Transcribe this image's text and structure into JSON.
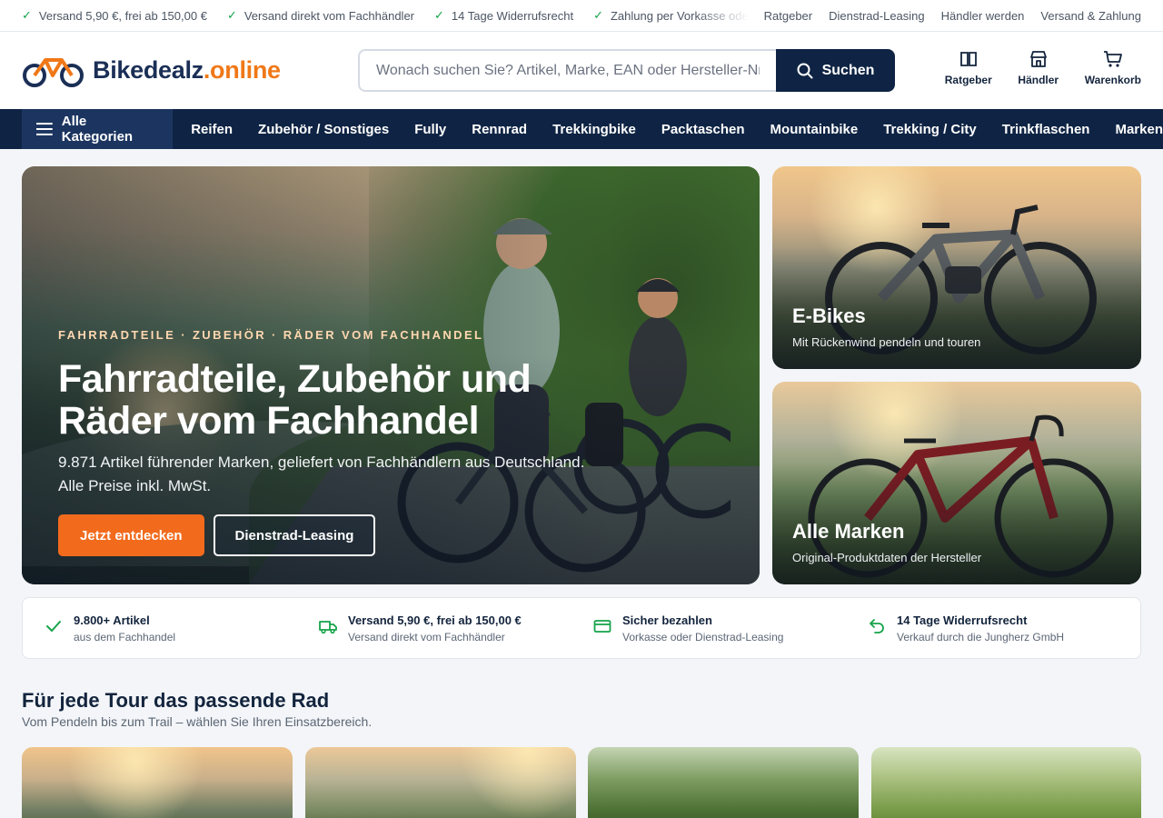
{
  "topbar": {
    "usps": [
      "Versand 5,90 €, frei ab 150,00 €",
      "Versand direkt vom Fachhändler",
      "14 Tage Widerrufsrecht",
      "Zahlung per Vorkasse oder"
    ],
    "links": [
      "Ratgeber",
      "Dienstrad-Leasing",
      "Händler werden",
      "Versand & Zahlung"
    ]
  },
  "header": {
    "logo_main": "Bikedealz",
    "logo_tld": ".online",
    "search_placeholder": "Wonach suchen Sie? Artikel, Marke, EAN oder Hersteller-Nr.",
    "search_button": "Suchen",
    "icons": [
      {
        "label": "Ratgeber",
        "icon": "book-icon"
      },
      {
        "label": "Händler",
        "icon": "store-icon"
      },
      {
        "label": "Warenkorb",
        "icon": "cart-icon"
      }
    ]
  },
  "nav": {
    "all_categories": "Alle Kategorien",
    "items": [
      "Reifen",
      "Zubehör / Sonstiges",
      "Fully",
      "Rennrad",
      "Trekkingbike",
      "Packtaschen",
      "Mountainbike",
      "Trekking / City",
      "Trinkflaschen",
      "Marken"
    ]
  },
  "hero": {
    "kicker": "FAHRRADTEILE · ZUBEHÖR · RÄDER VOM FACHHANDEL",
    "title_line1": "Fahrradteile, Zubehör und",
    "title_line2": "Räder vom Fachhandel",
    "subtitle_line1": "9.871 Artikel führender Marken, geliefert von Fachhändlern aus Deutschland.",
    "subtitle_line2": "Alle Preise inkl. MwSt.",
    "primary_button": "Jetzt entdecken",
    "secondary_button": "Dienstrad-Leasing"
  },
  "side_cards": [
    {
      "title": "E-Bikes",
      "subtitle": "Mit Rückenwind pendeln und touren"
    },
    {
      "title": "Alle Marken",
      "subtitle": "Original-Produktdaten der Hersteller"
    }
  ],
  "features": [
    {
      "title": "9.800+ Artikel",
      "subtitle": "aus dem Fachhandel",
      "icon": "check-icon"
    },
    {
      "title": "Versand 5,90 €, frei ab 150,00 €",
      "subtitle": "Versand direkt vom Fachhändler",
      "icon": "truck-icon"
    },
    {
      "title": "Sicher bezahlen",
      "subtitle": "Vorkasse oder Dienstrad-Leasing",
      "icon": "credit-card-icon"
    },
    {
      "title": "14 Tage Widerrufsrecht",
      "subtitle": "Verkauf durch die Jungherz GmbH",
      "icon": "return-icon"
    }
  ],
  "section": {
    "title": "Für jede Tour das passende Rad",
    "subtitle": "Vom Pendeln bis zum Trail – wählen Sie Ihren Einsatzbereich."
  },
  "colors": {
    "navy": "#0f2444",
    "accent_orange": "#f26b1d",
    "success_green": "#16a34a"
  }
}
